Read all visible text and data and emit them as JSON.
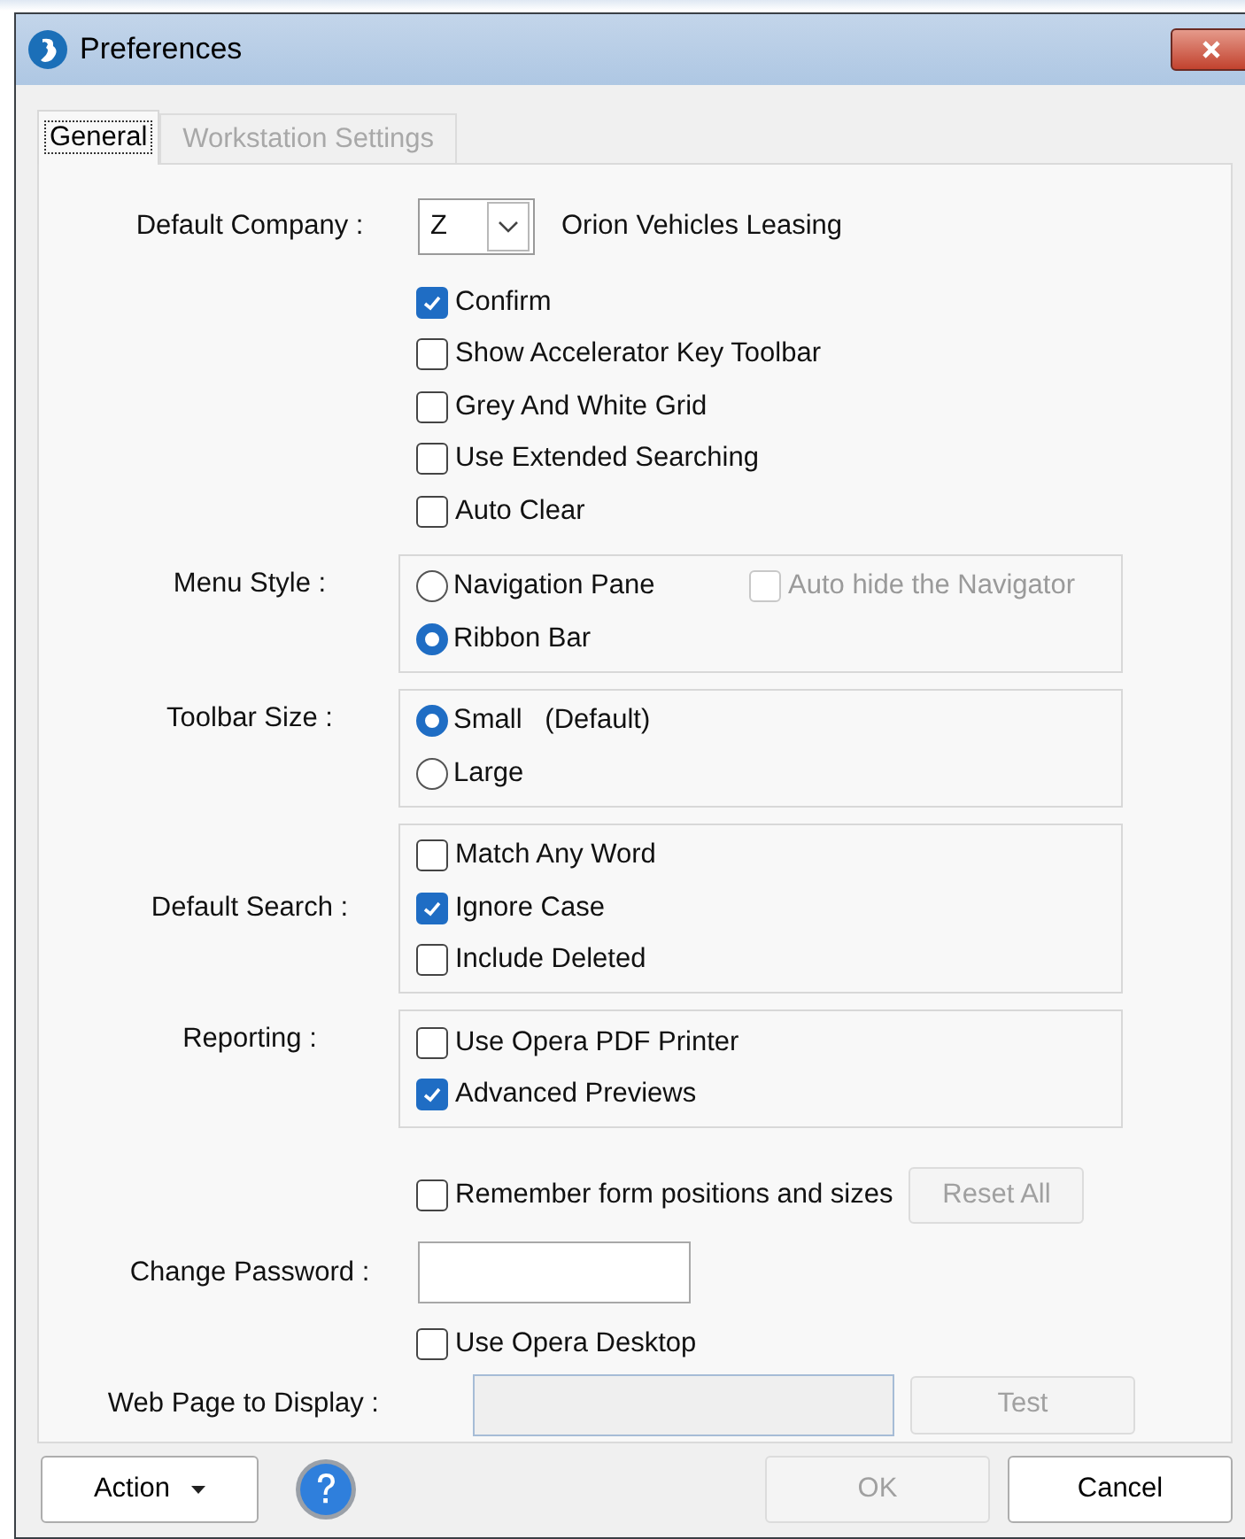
{
  "window": {
    "title": "Preferences"
  },
  "tabs": [
    {
      "label": "General",
      "selected": true
    },
    {
      "label": "Workstation Settings",
      "selected": false
    }
  ],
  "company": {
    "label": "Default Company :",
    "code": "Z",
    "name": "Orion Vehicles Leasing"
  },
  "options": [
    {
      "label": "Confirm",
      "checked": true
    },
    {
      "label": "Show Accelerator Key Toolbar",
      "checked": false
    },
    {
      "label": "Grey And White Grid",
      "checked": false
    },
    {
      "label": "Use Extended Searching",
      "checked": false
    },
    {
      "label": "Auto Clear",
      "checked": false
    }
  ],
  "menu_style": {
    "label": "Menu Style :",
    "options": [
      {
        "label": "Navigation Pane",
        "selected": false
      },
      {
        "label": "Ribbon Bar",
        "selected": true
      }
    ],
    "auto_hide": {
      "label": "Auto hide the Navigator",
      "checked": false,
      "disabled": true
    }
  },
  "toolbar_size": {
    "label": "Toolbar Size :",
    "options": [
      {
        "label": "Small   (Default)",
        "selected": true
      },
      {
        "label": "Large",
        "selected": false
      }
    ]
  },
  "default_search": {
    "label": "Default Search :",
    "options": [
      {
        "label": "Match Any Word",
        "checked": false
      },
      {
        "label": "Ignore Case",
        "checked": true
      },
      {
        "label": "Include Deleted",
        "checked": false
      }
    ]
  },
  "reporting": {
    "label": "Reporting :",
    "options": [
      {
        "label": "Use Opera PDF Printer",
        "checked": false
      },
      {
        "label": "Advanced Previews",
        "checked": true
      }
    ]
  },
  "remember": {
    "label": "Remember form positions and sizes",
    "checked": false
  },
  "reset_button": {
    "label": "Reset All",
    "disabled": true
  },
  "change_password": {
    "label": "Change Password :"
  },
  "use_opera_desktop": {
    "label": "Use Opera Desktop",
    "checked": false
  },
  "web_page": {
    "label": "Web Page to Display :",
    "disabled": true
  },
  "test_button": {
    "label": "Test",
    "disabled": true
  },
  "footer": {
    "action": "Action",
    "ok": {
      "label": "OK",
      "disabled": true
    },
    "cancel": {
      "label": "Cancel",
      "disabled": false
    }
  }
}
